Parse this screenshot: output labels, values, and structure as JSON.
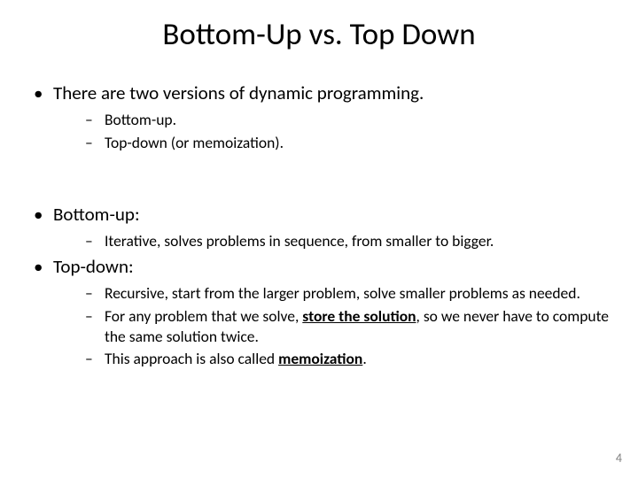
{
  "title": "Bottom-Up vs. Top Down",
  "b1": {
    "text": "There are two versions of dynamic programming.",
    "sub": [
      "Bottom-up.",
      "Top-down (or memoization)."
    ]
  },
  "b2": {
    "text": "Bottom-up:",
    "sub": [
      "Iterative, solves problems in sequence, from smaller to bigger."
    ]
  },
  "b3": {
    "text": "Top-down:",
    "sub1a": "Recursive, start from the larger problem, solve smaller problems as needed.",
    "sub2a": "For any problem that we solve, ",
    "sub2b": "store the solution",
    "sub2c": ", so we never have to compute the same solution twice.",
    "sub3a": "This approach is also called ",
    "sub3b": "memoization",
    "sub3c": "."
  },
  "pagenum": "4"
}
